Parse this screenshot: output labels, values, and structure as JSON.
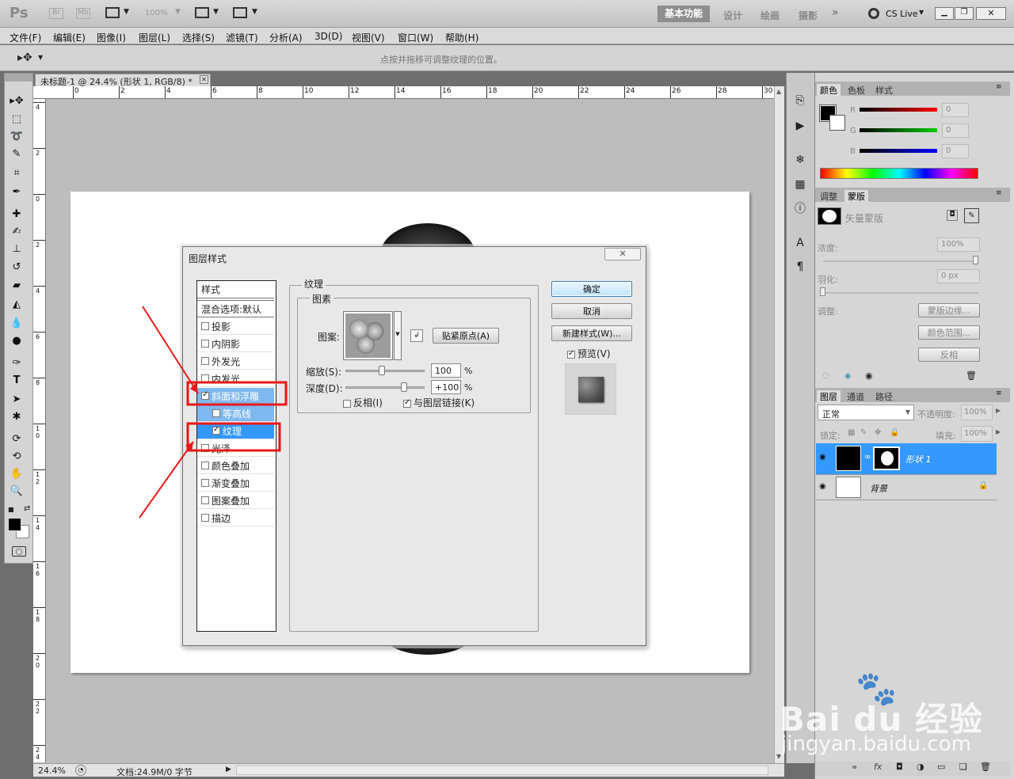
{
  "app": {
    "logo": "Ps",
    "bridge_label": "Br",
    "minibridge_label": "Mb",
    "zoom_label": "100%",
    "workspaces": [
      "基本功能",
      "设计",
      "绘画",
      "摄影"
    ],
    "cslive": "CS Live"
  },
  "menu": [
    "文件(F)",
    "编辑(E)",
    "图像(I)",
    "图层(L)",
    "选择(S)",
    "滤镜(T)",
    "分析(A)",
    "3D(D)",
    "视图(V)",
    "窗口(W)",
    "帮助(H)"
  ],
  "options_bar": {
    "hint": "点按并拖移可调整纹理的位置。"
  },
  "document": {
    "tab_title": "未标题-1 @ 24.4% (形状 1, RGB/8) *",
    "ruler_top": [
      "0",
      "2",
      "4",
      "6",
      "8",
      "10",
      "12",
      "14",
      "16",
      "18",
      "20",
      "22",
      "24",
      "26",
      "28",
      "30"
    ],
    "ruler_left": [
      "4",
      "2",
      "0",
      "2",
      "4",
      "6",
      "8",
      "1\n0",
      "1\n2",
      "1\n4",
      "1\n6",
      "1\n8",
      "2\n0",
      "2\n2",
      "2\n4"
    ],
    "status_zoom": "24.4%",
    "status_doc": "文档:24.9M/0 字节"
  },
  "dialog": {
    "title": "图层样式",
    "styles_header": "样式",
    "blend_options": "混合选项:默认",
    "styles": [
      {
        "label": "投影",
        "checked": false
      },
      {
        "label": "内阴影",
        "checked": false
      },
      {
        "label": "外发光",
        "checked": false
      },
      {
        "label": "内发光",
        "checked": false
      },
      {
        "label": "斜面和浮雕",
        "checked": true
      },
      {
        "label": "等高线",
        "checked": false
      },
      {
        "label": "纹理",
        "checked": true
      },
      {
        "label": "光泽",
        "checked": false
      },
      {
        "label": "颜色叠加",
        "checked": false
      },
      {
        "label": "渐变叠加",
        "checked": false
      },
      {
        "label": "图案叠加",
        "checked": false
      },
      {
        "label": "描边",
        "checked": false
      }
    ],
    "group_title": "纹理",
    "subgroup_title": "图素",
    "pattern_label": "图案:",
    "snap_button": "贴紧原点(A)",
    "scale_label": "缩放(S):",
    "scale_value": "100",
    "scale_percent": 0.45,
    "depth_label": "深度(D):",
    "depth_value": "+100",
    "depth_percent": 0.75,
    "unit": "%",
    "invert_label": "反相(I)",
    "invert_checked": false,
    "link_label": "与图层链接(K)",
    "link_checked": true,
    "ok": "确定",
    "cancel": "取消",
    "new_style": "新建样式(W)...",
    "preview_label": "预览(V)",
    "preview_checked": true
  },
  "color_panel": {
    "tabs": [
      "颜色",
      "色板",
      "样式"
    ],
    "channels": [
      {
        "name": "R",
        "value": "0",
        "color": "#e01010"
      },
      {
        "name": "G",
        "value": "0",
        "color": "#10c010"
      },
      {
        "name": "B",
        "value": "0",
        "color": "#1010e0"
      }
    ]
  },
  "masks_panel": {
    "tabs": [
      "调整",
      "蒙版"
    ],
    "vector_mask": "矢量蒙版",
    "density_label": "浓度:",
    "density_value": "100%",
    "feather_label": "羽化:",
    "feather_value": "0 px",
    "refine_label": "调整:",
    "mask_edge": "蒙版边缘...",
    "color_range": "颜色范围...",
    "invert": "反相"
  },
  "layers_panel": {
    "tabs": [
      "图层",
      "通道",
      "路径"
    ],
    "blend_mode": "正常",
    "opacity_label": "不透明度:",
    "opacity": "100%",
    "lock_label": "锁定:",
    "fill_label": "填充:",
    "fill": "100%",
    "layers": [
      {
        "name": "形状 1",
        "selected": true
      },
      {
        "name": "背景",
        "selected": false
      }
    ]
  },
  "watermark": {
    "brand": "Bai du 经验",
    "url": "jingyan.baidu.com"
  },
  "colors": {
    "accent": "#3c9cf0",
    "highlight": "#e81818",
    "selection": "#3399ff",
    "panel": "#d6d6d6"
  }
}
